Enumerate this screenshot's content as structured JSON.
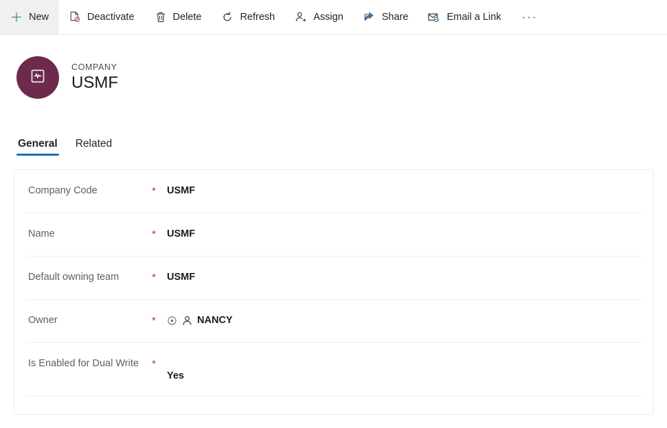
{
  "commandbar": {
    "buttons": [
      {
        "label": "New",
        "icon": "plus-icon",
        "hover": true
      },
      {
        "label": "Deactivate",
        "icon": "deactivate-icon",
        "hover": false
      },
      {
        "label": "Delete",
        "icon": "trash-icon",
        "hover": false
      },
      {
        "label": "Refresh",
        "icon": "refresh-icon",
        "hover": false
      },
      {
        "label": "Assign",
        "icon": "assign-person-icon",
        "hover": false
      },
      {
        "label": "Share",
        "icon": "share-icon",
        "hover": false
      },
      {
        "label": "Email a Link",
        "icon": "email-link-icon",
        "hover": false
      }
    ],
    "overflow_label": "···"
  },
  "record_header": {
    "entity_label": "COMPANY",
    "title": "USMF",
    "avatar_icon": "company-grid-icon",
    "avatar_color": "#6d2a4c"
  },
  "tabs": [
    {
      "label": "General",
      "selected": true
    },
    {
      "label": "Related",
      "selected": false
    }
  ],
  "tab_accent_color": "#1e6fb8",
  "form": {
    "required_marker": "*",
    "fields": [
      {
        "label": "Company Code",
        "required": true,
        "value": "USMF",
        "has_lock_icon": false,
        "has_person_icon": false,
        "tall": false
      },
      {
        "label": "Name",
        "required": true,
        "value": "USMF",
        "has_lock_icon": false,
        "has_person_icon": false,
        "tall": false
      },
      {
        "label": "Default owning team",
        "required": true,
        "value": "USMF",
        "has_lock_icon": false,
        "has_person_icon": false,
        "tall": false
      },
      {
        "label": "Owner",
        "required": true,
        "value": "NANCY",
        "has_lock_icon": true,
        "has_person_icon": true,
        "tall": false
      },
      {
        "label": "Is Enabled for Dual Write",
        "required": true,
        "value": "Yes",
        "has_lock_icon": false,
        "has_person_icon": false,
        "tall": true
      }
    ]
  }
}
